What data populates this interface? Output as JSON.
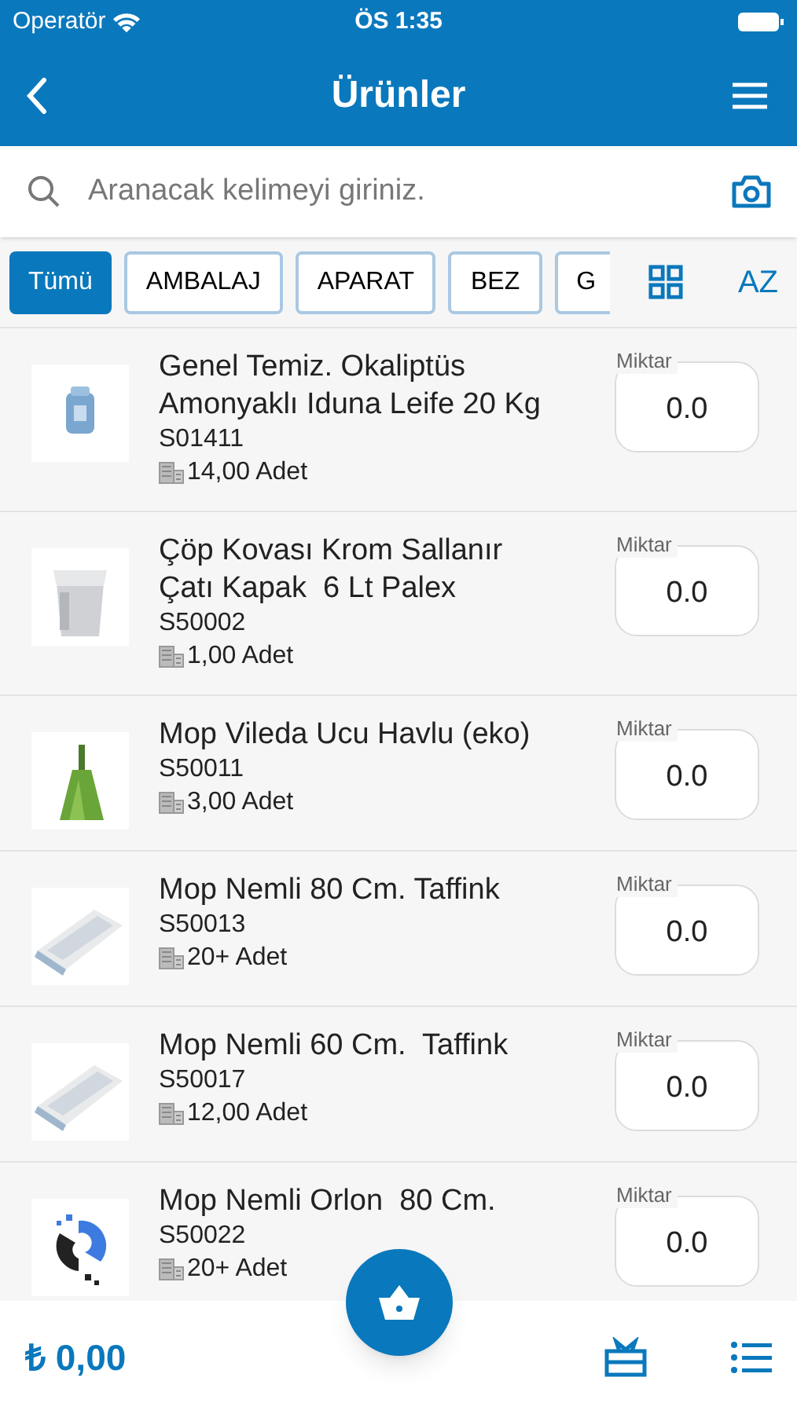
{
  "status_bar": {
    "carrier": "Operatör",
    "time": "ÖS 1:35"
  },
  "header": {
    "title": "Ürünler"
  },
  "search": {
    "placeholder": "Aranacak kelimeyi giriniz."
  },
  "categories": [
    {
      "label": "Tümü",
      "selected": true
    },
    {
      "label": "AMBALAJ",
      "selected": false
    },
    {
      "label": "APARAT",
      "selected": false
    },
    {
      "label": "BEZ",
      "selected": false
    },
    {
      "label": "G",
      "selected": false
    }
  ],
  "sort_button": {
    "label": "AZ"
  },
  "products": [
    {
      "name": "Genel Temiz. Okaliptüs Amonyaklı Iduna Leife 20 Kg",
      "code": "S01411",
      "stock": "14,00 Adet",
      "quantity_label": "Miktar",
      "quantity": "0.0"
    },
    {
      "name": "Çöp Kovası Krom Sallanır Çatı Kapak  6 Lt Palex",
      "code": "S50002",
      "stock": "1,00 Adet",
      "quantity_label": "Miktar",
      "quantity": "0.0"
    },
    {
      "name": "Mop Vileda Ucu Havlu (eko)",
      "code": "S50011",
      "stock": "3,00 Adet",
      "quantity_label": "Miktar",
      "quantity": "0.0"
    },
    {
      "name": "Mop Nemli 80 Cm. Taffink",
      "code": "S50013",
      "stock": "20+ Adet",
      "quantity_label": "Miktar",
      "quantity": "0.0"
    },
    {
      "name": "Mop Nemli 60 Cm.  Taffink",
      "code": "S50017",
      "stock": "12,00 Adet",
      "quantity_label": "Miktar",
      "quantity": "0.0"
    },
    {
      "name": "Mop Nemli Orlon  80 Cm.",
      "code": "S50022",
      "stock": "20+ Adet",
      "quantity_label": "Miktar",
      "quantity": "0.0"
    }
  ],
  "footer": {
    "total": "₺ 0,00"
  }
}
